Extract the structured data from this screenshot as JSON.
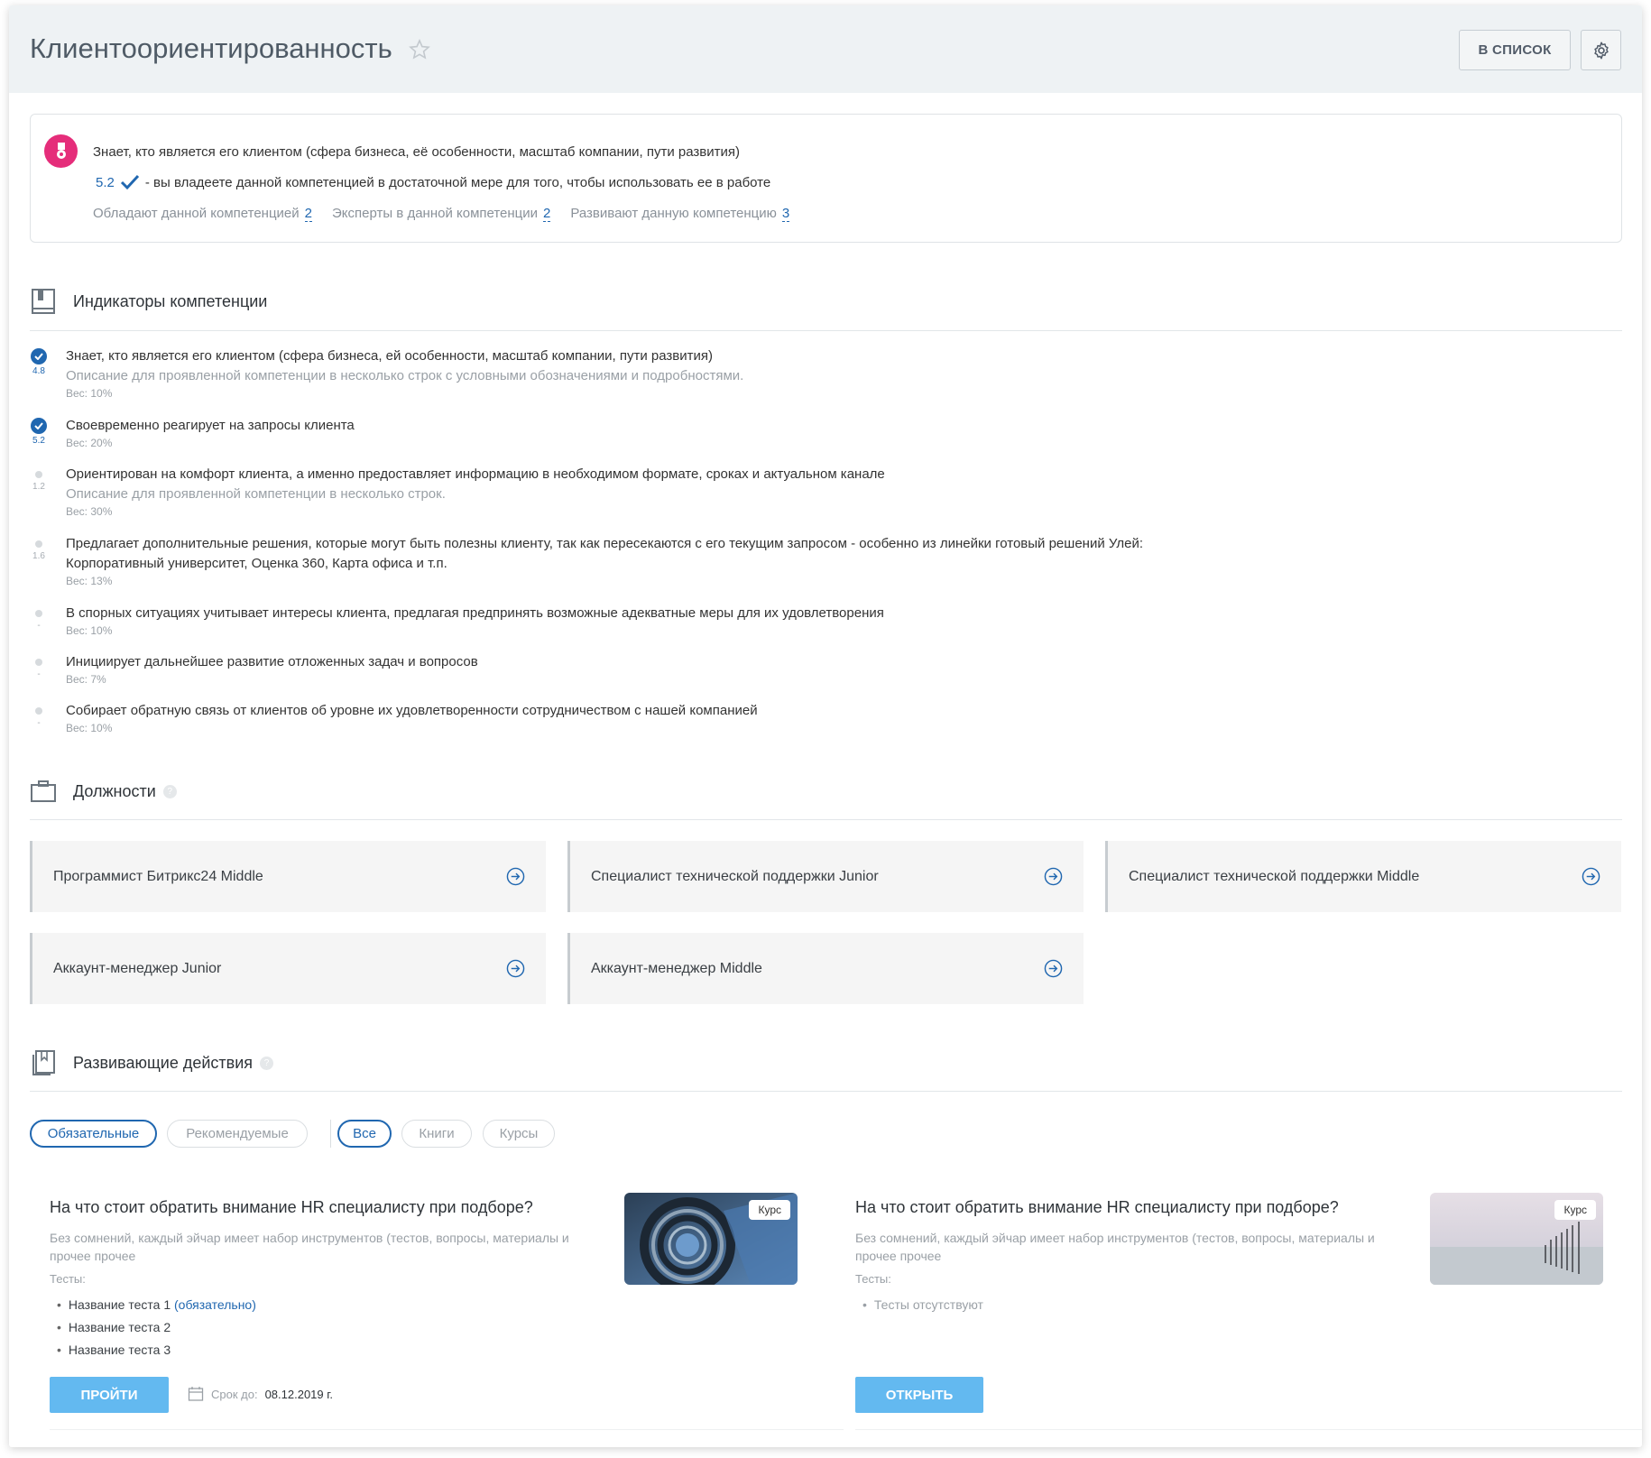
{
  "header": {
    "title": "Клиентоориентированность",
    "list_button": "В СПИСОК"
  },
  "summary": {
    "description": "Знает, кто является его клиентом (сфера бизнеса, её особенности, масштаб компании, пути развития)",
    "score": "5.2",
    "level_text": "- вы владеете данной компетенцией в достаточной мере для того, чтобы использовать ее в работе",
    "stats": [
      {
        "label": "Обладают данной компетенцией",
        "value": "2"
      },
      {
        "label": "Эксперты в данной компетенции",
        "value": "2"
      },
      {
        "label": "Развивают данную компетенцию",
        "value": "3"
      }
    ]
  },
  "indicators": {
    "title": "Индикаторы компетенции",
    "items": [
      {
        "score": "4.8",
        "title": "Знает, кто является его клиентом (сфера бизнеса, ей особенности, масштаб компании, пути развития)",
        "description": "Описание для проявленной компетенции в несколько строк с условными обозначениями и подробностями.",
        "weight": "Вес: 10%"
      },
      {
        "score": "5.2",
        "title": "Своевременно реагирует на запросы клиента",
        "description": "",
        "weight": "Вес: 20%"
      },
      {
        "score": "1.2",
        "title": "Ориентирован на комфорт клиента, а именно предоставляет информацию в необходимом формате, сроках и актуальном канале",
        "description": "Описание для проявленной компетенции в несколько строк.",
        "weight": "Вес: 30%"
      },
      {
        "score": "1.6",
        "title": "Предлагает дополнительные решения, которые могут быть полезны клиенту, так как пересекаются с его текущим запросом - особенно из линейки готовый решений Улей:",
        "title2": "Корпоративный университет, Оценка 360, Карта офиса и т.п.",
        "description": "",
        "weight": "Вес: 13%"
      },
      {
        "score": "-",
        "title": "В спорных ситуациях учитывает интересы клиента, предлагая предпринять возможные адекватные меры для их удовлетворения",
        "description": "",
        "weight": "Вес: 10%"
      },
      {
        "score": "-",
        "title": "Инициирует дальнейшее развитие отложенных задач и вопросов",
        "description": "",
        "weight": "Вес: 7%"
      },
      {
        "score": "-",
        "title": "Собирает обратную связь от клиентов об уровне их удовлетворенности сотрудничеством с нашей компанией",
        "description": "",
        "weight": "Вес: 10%"
      }
    ]
  },
  "positions": {
    "title": "Должности",
    "items": [
      "Программист Битрикс24 Middle",
      "Специалист технической поддержки Junior",
      "Специалист технической поддержки Middle",
      "Аккаунт-менеджер Junior",
      "Аккаунт-менеджер Middle"
    ]
  },
  "actions": {
    "title": "Развивающие действия",
    "filters": {
      "mandatory": "Обязательные",
      "recommended": "Рекомендуемые",
      "all": "Все",
      "books": "Книги",
      "courses": "Курсы"
    },
    "items": [
      {
        "title": "На что стоит обратить внимание HR специалисту при подборе?",
        "description": "Без сомнений, каждый эйчар имеет набор инструментов (тестов, вопросы, материалы и прочее прочее",
        "tests_label": "Тесты:",
        "tests": [
          "Название теста 1",
          "Название теста 2",
          "Название теста 3"
        ],
        "required_note": "(обязательно)",
        "badge": "Курс",
        "button": "ПРОЙТИ",
        "deadline_label": "Срок до:",
        "deadline": "08.12.2019 г."
      },
      {
        "title": "На что стоит обратить внимание HR специалисту при подборе?",
        "description": "Без сомнений, каждый эйчар имеет набор инструментов (тестов, вопросы, материалы и прочее прочее",
        "tests_label": "Тесты:",
        "no_tests": "Тесты отсутствуют",
        "badge": "Курс",
        "button": "ОТКРЫТЬ"
      }
    ]
  },
  "colors": {
    "accent": "#2067b0",
    "button": "#63b9f0",
    "medal": "#e52d7a",
    "header_bg": "#eef2f4"
  }
}
